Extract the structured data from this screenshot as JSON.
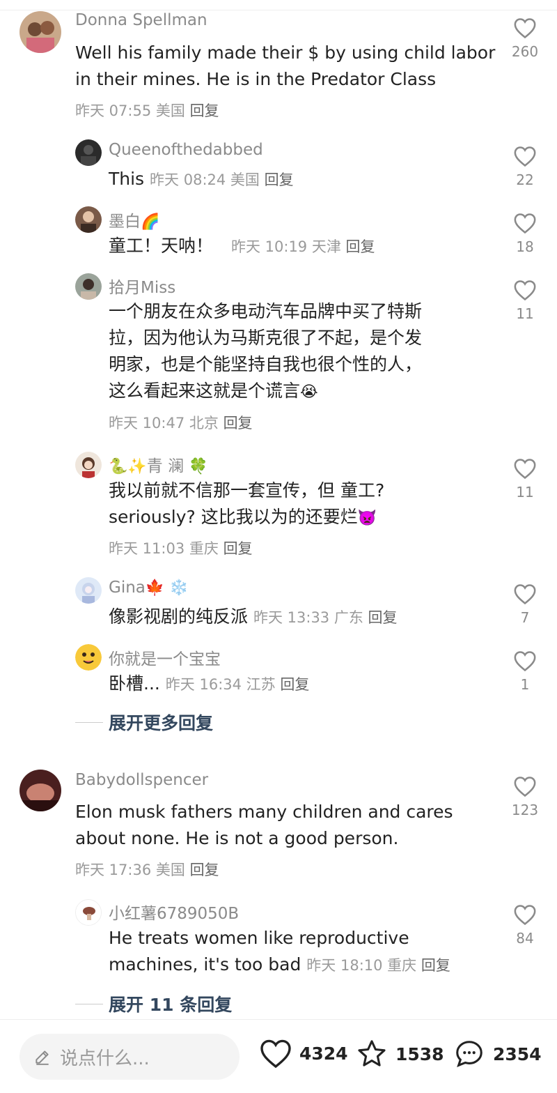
{
  "comments": [
    {
      "user": "Donna Spellman",
      "text_lines": [
        "Well his family made their $ by using child labor",
        "in their mines.   He is in the Predator Class"
      ],
      "meta": "昨天 07:55 美国",
      "reply": "回复",
      "likes": "260"
    },
    {
      "user": "Queenofthedabbed",
      "text": "This",
      "meta": "昨天 08:24 美国",
      "reply": "回复",
      "likes": "22"
    },
    {
      "user": "墨白",
      "user_emoji": "🌈",
      "text": "童工！天呐！",
      "meta": "昨天 10:19 天津",
      "reply": "回复",
      "likes": "18"
    },
    {
      "user": "拾月Miss",
      "text_lines": [
        "一个朋友在众多电动汽车品牌中买了特斯",
        "拉，因为他认为马斯克很了不起，是个发",
        "明家，也是个能坚持自我也很个性的人，",
        "这么看起来这就是个谎言"
      ],
      "text_emoji": "😭",
      "meta": "昨天 10:47 北京",
      "reply": "回复",
      "likes": "11"
    },
    {
      "user_prefix": "🐍✨",
      "user": "青 澜",
      "user_emoji": "🍀",
      "text_lines": [
        "我以前就不信那一套宣传，但 童工?",
        "seriously? 这比我以为的还要烂"
      ],
      "text_emoji": "👿",
      "meta": "昨天 11:03 重庆",
      "reply": "回复",
      "likes": "11"
    },
    {
      "user": "Gina",
      "user_emoji": "🍁 ❄️",
      "text": "像影视剧的纯反派",
      "meta": "昨天 13:33 广东",
      "reply": "回复",
      "likes": "7"
    },
    {
      "user": "你就是一个宝宝",
      "text": "卧槽...",
      "meta": "昨天 16:34 江苏",
      "reply": "回复",
      "likes": "1"
    },
    {
      "user": "Babydollspencer",
      "text_lines": [
        "Elon musk fathers many children and cares",
        "about none. He is not a good person."
      ],
      "meta": "昨天 17:36 美国",
      "reply": "回复",
      "likes": "123"
    },
    {
      "user": "小红薯6789050B",
      "text_lines": [
        "He treats women like reproductive",
        "machines, it's too bad"
      ],
      "meta": "昨天 18:10 重庆",
      "reply": "回复",
      "likes": "84"
    }
  ],
  "expand_more": "展开更多回复",
  "expand_11": "展开 11 条回复",
  "bottom_bar": {
    "placeholder": "说点什么...",
    "likes": "4324",
    "stars": "1538",
    "comments": "2354"
  },
  "icons": [
    "heart-icon",
    "star-icon",
    "comment-bubble-icon",
    "pencil-icon"
  ],
  "colors": {
    "link": "#33475e",
    "meta": "#9a9a9a",
    "text": "#222222"
  }
}
